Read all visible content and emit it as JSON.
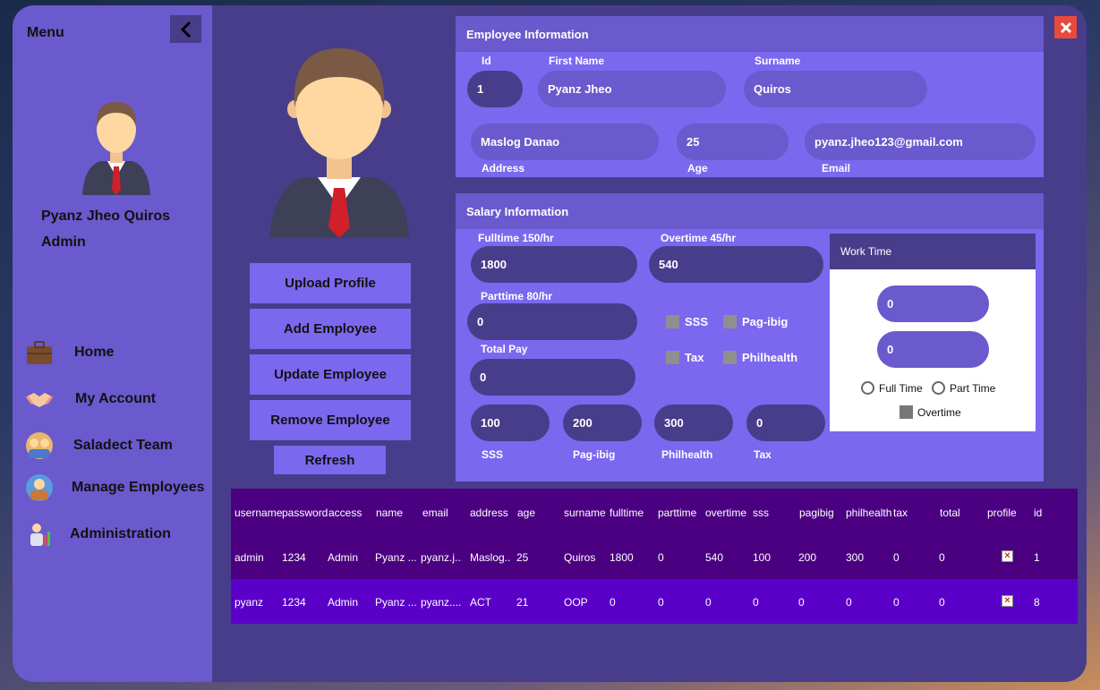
{
  "sidebar": {
    "menu_title": "Menu",
    "user_name": "Pyanz Jheo Quiros",
    "user_role": "Admin",
    "nav": [
      {
        "label": "Home",
        "icon": "briefcase-icon"
      },
      {
        "label": "My Account",
        "icon": "handshake-icon"
      },
      {
        "label": "Saladect Team",
        "icon": "team-icon"
      },
      {
        "label": "Manage Employees",
        "icon": "manage-employees-icon"
      },
      {
        "label": "Administration",
        "icon": "administration-icon"
      }
    ]
  },
  "actions": {
    "upload": "Upload Profile",
    "add": "Add Employee",
    "update": "Update Employee",
    "remove": "Remove Employee",
    "refresh": "Refresh"
  },
  "employee_info": {
    "header": "Employee Information",
    "id_label": "Id",
    "id": "1",
    "first_name_label": "First Name",
    "first_name": "Pyanz Jheo",
    "surname_label": "Surname",
    "surname": "Quiros",
    "address_label": "Address",
    "address": "Maslog Danao",
    "age_label": "Age",
    "age": "25",
    "email_label": "Email",
    "email": "pyanz.jheo123@gmail.com"
  },
  "salary_info": {
    "header": "Salary Information",
    "fulltime_label": "Fulltime 150/hr",
    "fulltime": "1800",
    "overtime_label": "Overtime 45/hr",
    "overtime": "540",
    "parttime_label": "Parttime 80/hr",
    "parttime": "0",
    "total_label": "Total Pay",
    "total": "0",
    "checkboxes": {
      "sss": "SSS",
      "pagibig": "Pag-ibig",
      "tax": "Tax",
      "philhealth": "Philhealth"
    },
    "deductions": [
      {
        "label": "SSS",
        "value": "100"
      },
      {
        "label": "Pag-ibig",
        "value": "200"
      },
      {
        "label": "Philhealth",
        "value": "300"
      },
      {
        "label": "Tax",
        "value": "0"
      }
    ]
  },
  "work_time": {
    "header": "Work Time",
    "hours1": "0",
    "hours2": "0",
    "full_time": "Full Time",
    "part_time": "Part Time",
    "overtime": "Overtime"
  },
  "table": {
    "columns": [
      "username",
      "password",
      "access",
      "name",
      "email",
      "address",
      "age",
      "surname",
      "fulltime",
      "parttime",
      "overtime",
      "sss",
      "pagibig",
      "philhealth",
      "tax",
      "total",
      "profile",
      "id"
    ],
    "rows": [
      [
        "admin",
        "1234",
        "Admin",
        "Pyanz ...",
        "pyanz.j...",
        "Maslog...",
        "25",
        "Quiros",
        "1800",
        "0",
        "540",
        "100",
        "200",
        "300",
        "0",
        "0",
        "",
        "1"
      ],
      [
        "pyanz",
        "1234",
        "Admin",
        "Pyanz ...",
        "pyanz....",
        "ACT",
        "21",
        "OOP",
        "0",
        "0",
        "0",
        "0",
        "0",
        "0",
        "0",
        "0",
        "",
        "8"
      ]
    ]
  },
  "colors": {
    "window": "#483d8b",
    "sidebar": "#6a5acd",
    "panel": "#7b68ee",
    "grid_header": "#4b0082",
    "row1": "#4b0082",
    "row2": "#5b00c8",
    "close": "#e84a3b"
  }
}
